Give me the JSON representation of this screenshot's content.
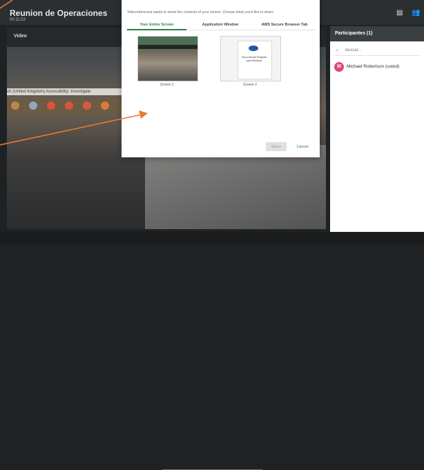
{
  "meeting": {
    "title": "Reunion de Operaciones",
    "time": "00:11:53"
  },
  "video": {
    "label": "Video",
    "background_text": "uh (United Kingdom)   Accessibility: Investigate"
  },
  "toolbar_icons": [
    "chat-icon",
    "people-icon"
  ],
  "participants": {
    "title": "Participantes (1)",
    "search_placeholder": "Buscar...",
    "list": [
      {
        "initial": "M",
        "name": "Michael Robertson (usted)",
        "avatar_color": "#e0457b"
      }
    ]
  },
  "share_dialog": {
    "message": "Teleconferencia wants to share the contents of your screen. Choose what you'd like to share.",
    "tabs": [
      "Your Entire Screen",
      "Application Window",
      "AWS Secure Browser Tab"
    ],
    "active_tab": 0,
    "screens": [
      {
        "label": "Screen 1"
      },
      {
        "label": "Screen 2",
        "doc_text": "Cisco Secure Endpoint para Windows"
      }
    ],
    "share_label": "Share",
    "cancel_label": "Cancel"
  },
  "colors": {
    "accent": "#2d7d46",
    "annotation_arrow": "#e87a2f",
    "avatar": "#e0457b"
  }
}
